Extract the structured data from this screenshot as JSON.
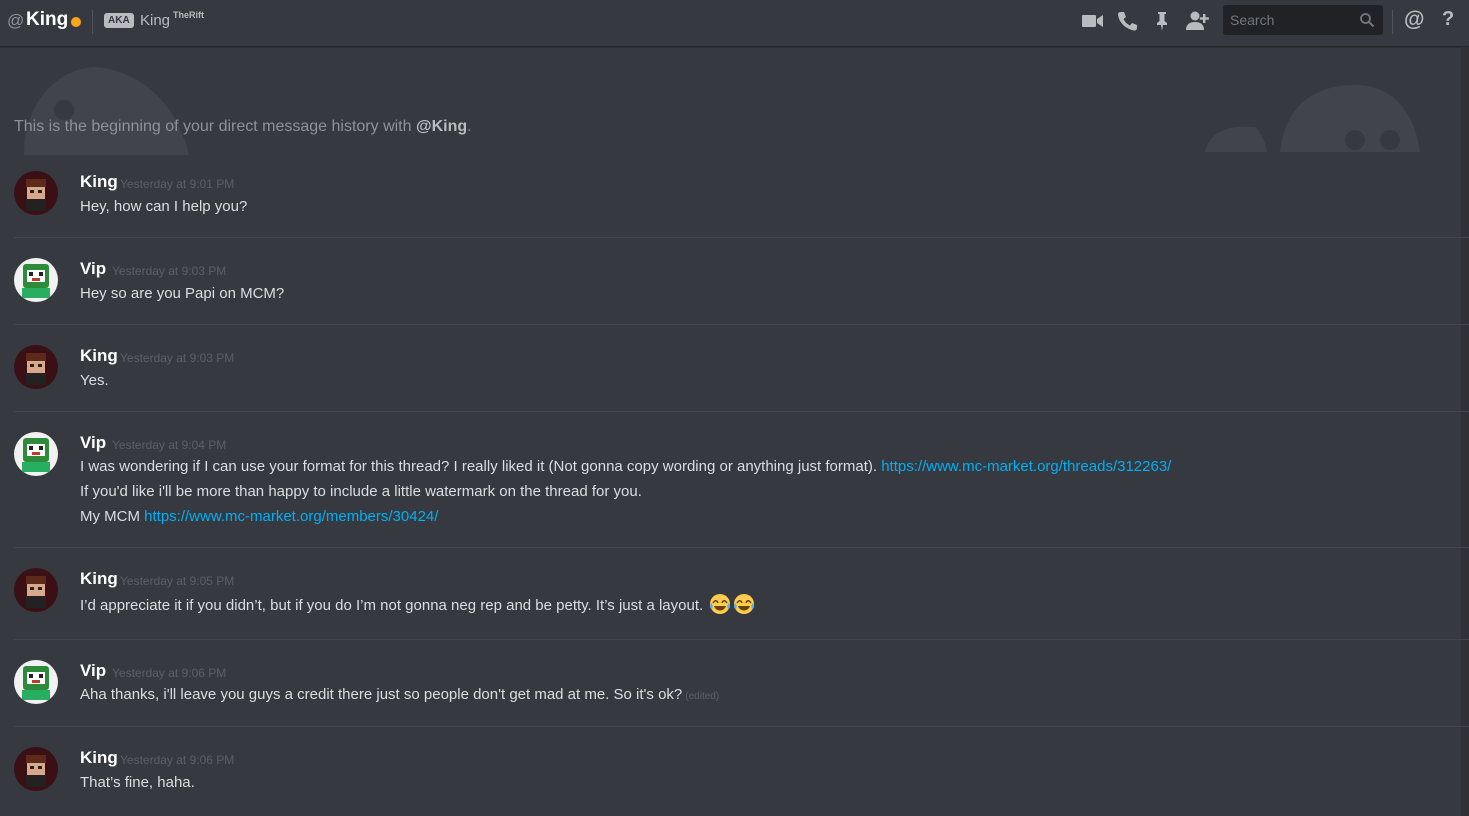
{
  "header": {
    "at_symbol": "@",
    "channel_name": "King",
    "status_color": "#faa61a",
    "aka_badge": "AKA",
    "aka_name": "King",
    "aka_superscript": "TheRift",
    "search_placeholder": "Search",
    "mention_symbol": "@",
    "help_symbol": "?"
  },
  "intro": {
    "text": "This is the beginning of your direct message history with ",
    "mention": "@King",
    "end": "."
  },
  "messages": [
    {
      "author": "King",
      "timestamp": "Yesterday at 9:01 PM",
      "lines": [
        "Hey, how can I help you?"
      ]
    },
    {
      "author": "Vip",
      "timestamp": "Yesterday at 9:03 PM",
      "lines": [
        "Hey so are you Papi on MCM?"
      ]
    },
    {
      "author": "King",
      "timestamp": "Yesterday at 9:03 PM",
      "lines": [
        "Yes."
      ]
    },
    {
      "author": "Vip",
      "timestamp": "Yesterday at 9:04 PM",
      "line1_text": "I was wondering if I can use your format for this thread? I really liked it (Not gonna copy wording or anything just format). ",
      "line1_link": "https://www.mc-market.org/threads/312263/",
      "line2_text": "If you'd like i'll be more than happy to include a little watermark on the thread for you.",
      "line3_text": "My MCM ",
      "line3_link": "https://www.mc-market.org/members/30424/"
    },
    {
      "author": "King",
      "timestamp": "Yesterday at 9:05 PM",
      "lines": [
        "I’d appreciate it if you didn’t, but if you do I’m not gonna neg rep and be petty. It’s just a layout."
      ],
      "emojis": [
        "joy-emoji",
        "joy-emoji"
      ]
    },
    {
      "author": "Vip",
      "timestamp": "Yesterday at 9:06 PM",
      "lines": [
        "Aha thanks, i'll leave you guys a credit there just so people don't get mad at me. So it's ok?"
      ],
      "edited": "(edited)"
    },
    {
      "author": "King",
      "timestamp": "Yesterday at 9:06 PM",
      "lines": [
        "That’s fine, haha."
      ]
    }
  ],
  "icons": [
    "video-call-icon",
    "voice-call-icon",
    "pin-icon",
    "add-friend-icon",
    "search-icon"
  ],
  "colors": {
    "background": "#36393f",
    "link": "#00b0f4",
    "author": "#ffffff",
    "timestamp": "#5c6066"
  }
}
